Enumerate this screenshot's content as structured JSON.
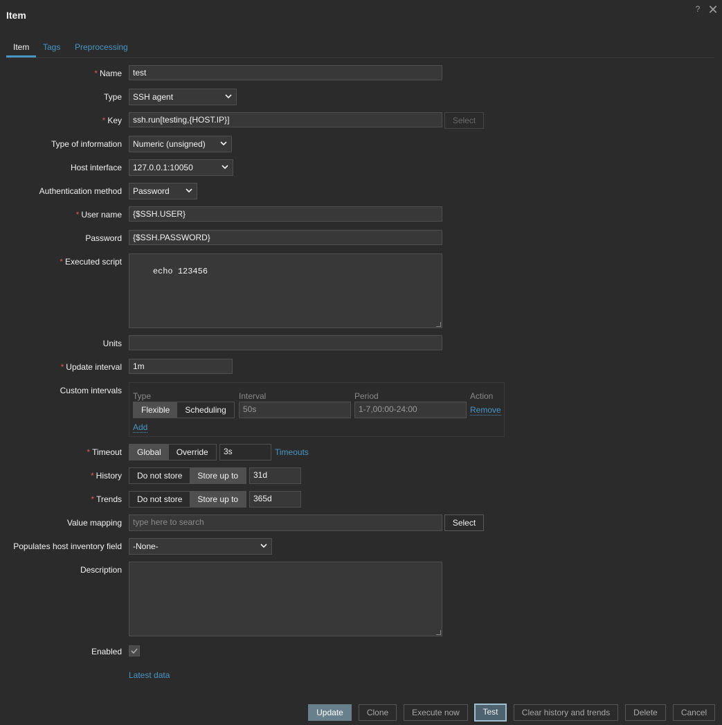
{
  "window": {
    "title": "Item"
  },
  "tabs": [
    {
      "label": "Item"
    },
    {
      "label": "Tags"
    },
    {
      "label": "Preprocessing"
    }
  ],
  "form": {
    "name": {
      "label": "Name",
      "value": "test"
    },
    "type": {
      "label": "Type",
      "value": "SSH agent"
    },
    "key": {
      "label": "Key",
      "value": "ssh.run[testing,{HOST.IP}]",
      "button": "Select"
    },
    "type_of_information": {
      "label": "Type of information",
      "value": "Numeric (unsigned)"
    },
    "host_interface": {
      "label": "Host interface",
      "value": "127.0.0.1:10050"
    },
    "auth_method": {
      "label": "Authentication method",
      "value": "Password"
    },
    "user_name": {
      "label": "User name",
      "value": "{$SSH.USER}"
    },
    "password": {
      "label": "Password",
      "value": "{$SSH.PASSWORD}"
    },
    "executed_script": {
      "label": "Executed script",
      "value": "echo 123456"
    },
    "units": {
      "label": "Units",
      "value": ""
    },
    "update_interval": {
      "label": "Update interval",
      "value": "1m"
    },
    "custom_intervals": {
      "label": "Custom intervals",
      "headers": {
        "type": "Type",
        "interval": "Interval",
        "period": "Period",
        "action": "Action"
      },
      "row": {
        "flexible": "Flexible",
        "scheduling": "Scheduling",
        "interval": "50s",
        "period": "1-7,00:00-24:00",
        "remove": "Remove"
      },
      "add": "Add"
    },
    "timeout": {
      "label": "Timeout",
      "global": "Global",
      "override": "Override",
      "value": "3s",
      "link": "Timeouts"
    },
    "history": {
      "label": "History",
      "do_not_store": "Do not store",
      "store_up_to": "Store up to",
      "value": "31d"
    },
    "trends": {
      "label": "Trends",
      "do_not_store": "Do not store",
      "store_up_to": "Store up to",
      "value": "365d"
    },
    "value_mapping": {
      "label": "Value mapping",
      "placeholder": "type here to search",
      "button": "Select"
    },
    "inventory_field": {
      "label": "Populates host inventory field",
      "value": "-None-"
    },
    "description": {
      "label": "Description",
      "value": ""
    },
    "enabled": {
      "label": "Enabled",
      "checked": true
    },
    "latest_data": "Latest data"
  },
  "footer": {
    "update": "Update",
    "clone": "Clone",
    "execute_now": "Execute now",
    "test": "Test",
    "clear_history": "Clear history and trends",
    "delete": "Delete",
    "cancel": "Cancel"
  },
  "colors": {
    "accent": "#4796c4",
    "required": "#e45959",
    "background": "#2b2b2b"
  },
  "icons": {
    "help": "question-mark",
    "close": "close-x",
    "dropdown": "chevron-down",
    "checkbox": "check-mark"
  }
}
